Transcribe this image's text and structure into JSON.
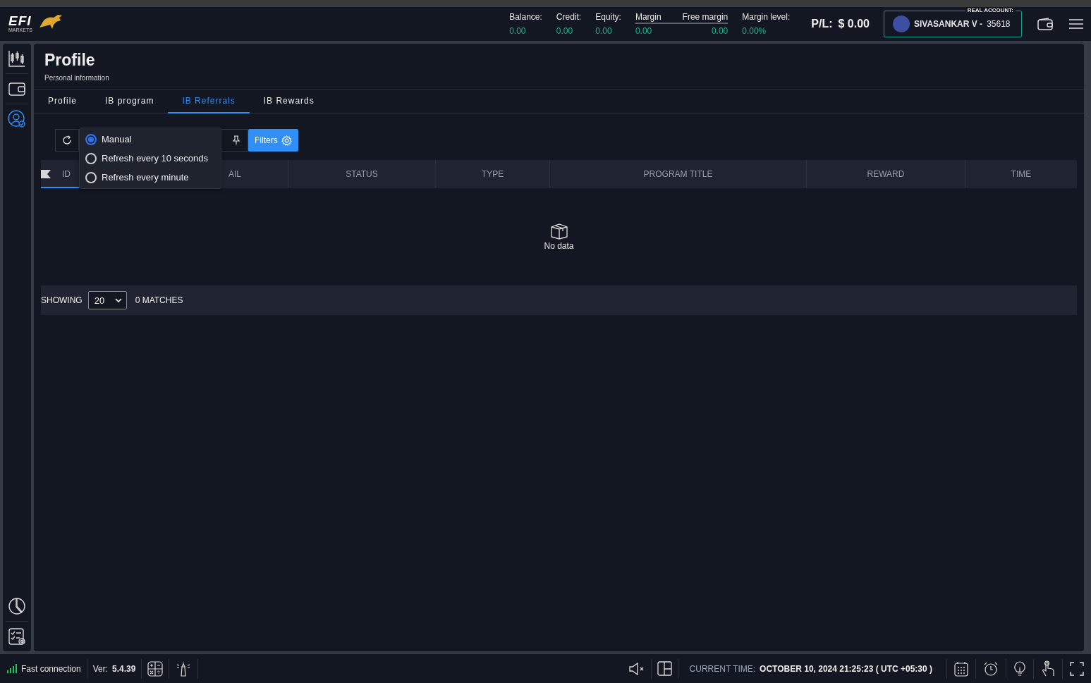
{
  "header": {
    "logo": {
      "text": "EFI",
      "subtext": "MARKETS"
    },
    "stats": [
      {
        "label": "Balance:",
        "value": "0.00"
      },
      {
        "label": "Credit:",
        "value": "0.00"
      },
      {
        "label": "Equity:",
        "value": "0.00"
      }
    ],
    "margin_group": [
      {
        "label": "Margin",
        "value": "0.00"
      },
      {
        "label": "Free margin",
        "value": "0.00"
      }
    ],
    "margin_level": {
      "label": "Margin level:",
      "value": "0.00%"
    },
    "pl": {
      "label": "P/L:",
      "value": "$ 0.00"
    },
    "account": {
      "badge": "REAL ACCOUNT:",
      "name": "SIVASANKAR V -",
      "number": "35618"
    }
  },
  "sidebar": {
    "items": [
      {
        "kind": "chart",
        "selected": false
      },
      {
        "kind": "wallet",
        "selected": false
      },
      {
        "kind": "profile",
        "selected": true
      }
    ],
    "bottom_items": [
      {
        "kind": "pie",
        "selected": false
      },
      {
        "kind": "tasks",
        "selected": false
      }
    ]
  },
  "page": {
    "title": "Profile",
    "subtitle": "Personal information"
  },
  "tabs": [
    {
      "label": "Profile",
      "selected": false
    },
    {
      "label": "IB program",
      "selected": false
    },
    {
      "label": "IB Referrals",
      "selected": true
    },
    {
      "label": "IB Rewards",
      "selected": false
    }
  ],
  "toolbar": {
    "filters_button": "Filters"
  },
  "refresh_menu": {
    "options": [
      {
        "label": "Manual",
        "selected": true
      },
      {
        "label": "Refresh every 10 seconds",
        "selected": false
      },
      {
        "label": "Refresh every minute",
        "selected": false
      }
    ]
  },
  "table": {
    "columns": [
      "ID",
      "AIL",
      "STATUS",
      "TYPE",
      "PROGRAM TITLE",
      "REWARD",
      "TIME"
    ],
    "empty_text": "No data"
  },
  "pagination": {
    "label": "SHOWING",
    "page_size": "20",
    "matches": "0 MATCHES"
  },
  "status_bar": {
    "connection": "Fast connection",
    "version_label": "Ver:",
    "version": "5.4.39",
    "time_label": "CURRENT TIME:",
    "time": "OCTOBER 10, 2024 21:25:23 ( UTC +05:30 )"
  }
}
